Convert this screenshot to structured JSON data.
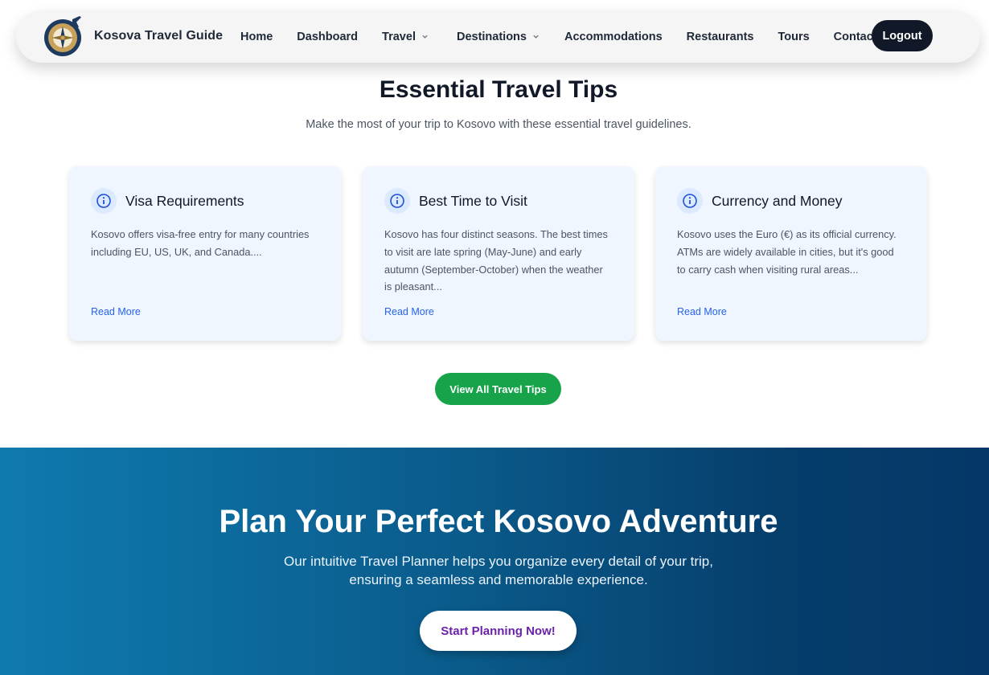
{
  "navbar": {
    "brand_name": "Kosova Travel Guide",
    "logo_icon": "compass-airplane-logo",
    "links": [
      {
        "label": "Home",
        "has_dropdown": false
      },
      {
        "label": "Dashboard",
        "has_dropdown": false
      },
      {
        "label": "Travel",
        "has_dropdown": true
      },
      {
        "label": "Destinations",
        "has_dropdown": true
      },
      {
        "label": "Accommodations",
        "has_dropdown": false
      },
      {
        "label": "Restaurants",
        "has_dropdown": false
      },
      {
        "label": "Tours",
        "has_dropdown": false
      },
      {
        "label": "Contact",
        "has_dropdown": false
      }
    ],
    "logout_label": "Logout"
  },
  "tips": {
    "title": "Essential Travel Tips",
    "subtitle": "Make the most of your trip to Kosovo with these essential travel guidelines.",
    "cards": [
      {
        "icon": "info-icon",
        "title": "Visa Requirements",
        "lines": [
          "Kosovo offers visa-free entry for many countries",
          "including EU, US, UK, and Canada...."
        ],
        "link": "Read More"
      },
      {
        "icon": "info-icon",
        "title": "Best Time to Visit",
        "lines": [
          "Kosovo has four distinct seasons. The best times",
          "to visit are late spring (May-June) and early",
          "autumn (September-October) when the weather",
          "is pleasant..."
        ],
        "link": "Read More"
      },
      {
        "icon": "info-icon",
        "title": "Currency and Money",
        "lines": [
          "Kosovo uses the Euro (€) as its official currency.",
          "ATMs are widely available in cities, but it's good",
          "to carry cash when visiting rural areas..."
        ],
        "link": "Read More"
      }
    ],
    "view_all_label": "View All Travel Tips"
  },
  "planner": {
    "title": "Plan Your Perfect Kosovo Adventure",
    "text_line1": "Our intuitive Travel Planner helps you organize every detail of your trip,",
    "text_line2": "ensuring a seamless and memorable experience.",
    "cta_label": "Start Planning Now!"
  },
  "colors": {
    "navbar_bg": "#f5f5f5",
    "logout_bg": "#111827",
    "card_bg": "#eff6ff",
    "link_blue": "#2563eb",
    "view_all_green": "#16a34a",
    "cta_text_purple": "#6b21a8",
    "planner_gradient_start": "#0f7aae",
    "planner_gradient_end": "#053868"
  }
}
